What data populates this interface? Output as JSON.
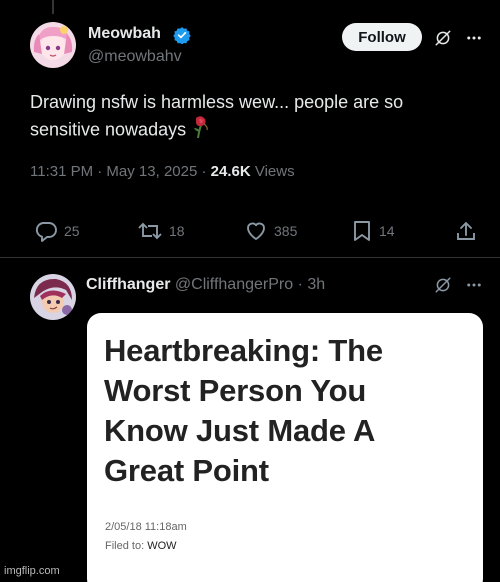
{
  "tweet": {
    "author_name": "Meowbah",
    "handle": "@meowbahv",
    "follow_label": "Follow",
    "text_line1": "Drawing nsfw is harmless wew... people are so",
    "text_line2": "sensitive nowadays",
    "time": "11:31 PM · May 13, 2025 · ",
    "views_count": "24.6K",
    "views_label": " Views",
    "stats": {
      "replies": "25",
      "reposts": "18",
      "likes": "385",
      "bookmarks": "14"
    },
    "verified_color": "#1d9bf0"
  },
  "reply": {
    "author_name": "Cliffhanger",
    "meta": " @CliffhangerPro · 3h",
    "card": {
      "headline_line1": "Heartbreaking: The",
      "headline_line2": "Worst Person You",
      "headline_line3": "Know Just Made A",
      "headline_line4": "Great Point",
      "date": "2/05/18 11:18am",
      "filed_prefix": "Filed to: ",
      "filed_tag": "WOW"
    }
  },
  "watermark": "imgflip.com"
}
